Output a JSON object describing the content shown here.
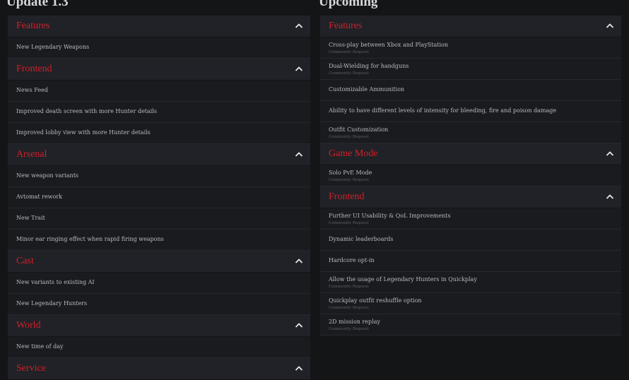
{
  "accent_color": "#d31f2a",
  "chevron_icon": "chevron-up-icon",
  "left": {
    "title": "Update 1.3",
    "sections": [
      {
        "title": "Features",
        "items": [
          {
            "title": "New Legendary Weapons"
          }
        ]
      },
      {
        "title": "Frontend",
        "items": [
          {
            "title": "News Feed"
          },
          {
            "title": "Improved death screen with more Hunter details"
          },
          {
            "title": "Improved lobby view with more Hunter details"
          }
        ]
      },
      {
        "title": "Arsenal",
        "items": [
          {
            "title": "New weapon variants"
          },
          {
            "title": "Avtomat rework"
          },
          {
            "title": "New Trait"
          },
          {
            "title": "Minor ear ringing effect when rapid firing weapons"
          }
        ]
      },
      {
        "title": "Cast",
        "items": [
          {
            "title": "New variants to existing AI"
          },
          {
            "title": "New Legendary Hunters"
          }
        ]
      },
      {
        "title": "World",
        "items": [
          {
            "title": "New time of day"
          }
        ]
      },
      {
        "title": "Service",
        "items": []
      }
    ]
  },
  "right": {
    "title": "Upcoming",
    "sections": [
      {
        "title": "Features",
        "items": [
          {
            "title": "Cross-play between Xbox and PlayStation",
            "tag": "Community Request"
          },
          {
            "title": "Dual-Wielding for handguns",
            "tag": "Community Request"
          },
          {
            "title": "Customizable Ammunition"
          },
          {
            "title": "Ability to have different levels of intensity for bleeding, fire and poison damage"
          },
          {
            "title": "Outfit Customization",
            "tag": "Community Request"
          }
        ]
      },
      {
        "title": "Game Mode",
        "items": [
          {
            "title": "Solo PvE Mode",
            "tag": "Community Request"
          }
        ]
      },
      {
        "title": "Frontend",
        "items": [
          {
            "title": "Further UI Usability & QoL Improvements",
            "tag": "Community Request"
          },
          {
            "title": "Dynamic leaderboards"
          },
          {
            "title": "Hardcore opt-in"
          },
          {
            "title": "Allow the usage of Legendary Hunters in Quickplay",
            "tag": "Community Request"
          },
          {
            "title": "Quickplay outfit reshuffle option",
            "tag": "Community Request"
          },
          {
            "title": "2D mission replay",
            "tag": "Community Request"
          }
        ]
      }
    ]
  }
}
